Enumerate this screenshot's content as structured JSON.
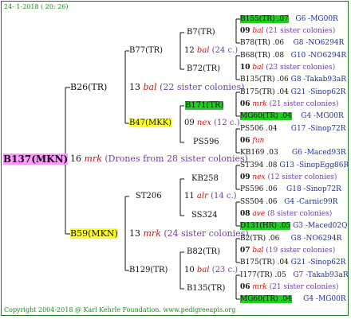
{
  "date": "24- 1-2018 ( 20: 26)",
  "footer": "Copyright 2004-2018 @ Karl Kehrle Foundation.   www.pedigreeapis.org",
  "root": {
    "id": "B137(MKN)",
    "num": "16",
    "race": "mrk",
    "note": "(Drones from 28 sister colonies)"
  },
  "gen1": {
    "top": {
      "id": "B26(TR)",
      "num": "13",
      "race": "bal",
      "note": "(22 sister colonies)"
    },
    "bottom": {
      "id": "B59(MKN)",
      "num": "13",
      "race": "mrk",
      "note": "(24 sister colonies)"
    }
  },
  "gen2": [
    {
      "id": "B77(TR)",
      "num": "12",
      "race": "bal",
      "note": "(24 c.)"
    },
    {
      "id": "B47(MKK)",
      "num": "09",
      "race": "nex",
      "note": "(12 c.)"
    },
    {
      "id": "ST206",
      "num": "11",
      "race": "alr",
      "note": "(14 c.)"
    },
    {
      "id": "B129(TR)",
      "num": "10",
      "race": "bal",
      "note": "(23 c.)"
    }
  ],
  "gen3": [
    "B7(TR)",
    "B72(TR)",
    "B171(TR)",
    "PS596",
    "KB258",
    "SS324",
    "B82(TR)",
    "B135(TR)"
  ],
  "right": [
    {
      "id": "B155(TR) .07",
      "loc": "G6 -MG00R"
    },
    {
      "num": "09",
      "race": "bal",
      "note": "(21 sister colonies)"
    },
    {
      "id": "B78(TR) .06",
      "loc": "G8 -NO6294R"
    },
    {
      "id": "B68(TR) .08",
      "loc": "G10 -NO6294R"
    },
    {
      "num": "10",
      "race": "bal",
      "note": "(23 sister colonies)"
    },
    {
      "id": "B135(TR) .06",
      "loc": "G8 -Takab93aR"
    },
    {
      "id": "B175(TR) .04",
      "loc": "G21 -Sinop62R"
    },
    {
      "num": "06",
      "race": "mrk",
      "note": "(21 sister colonies)"
    },
    {
      "id": "MG60(TR) .04",
      "loc": "G4 -MG00R"
    },
    {
      "id": "PS506 .04",
      "loc": "G17 -Sinop72R"
    },
    {
      "num": "06",
      "race": "fun",
      "note": ""
    },
    {
      "id": "KB169 .03",
      "loc": "G6 -Maced93R"
    },
    {
      "id": "ST394 .08",
      "loc": "G13 -SinopEgg86R"
    },
    {
      "num": "09",
      "race": "nex",
      "note": "(12 sister colonies)"
    },
    {
      "id": "PS596 .06",
      "loc": "G18 -Sinop72R"
    },
    {
      "id": "SS504 .06",
      "loc": "G4 -Carnic99R"
    },
    {
      "num": "08",
      "race": "ave",
      "note": "(8 sister colonies)"
    },
    {
      "id": "D131(HR) .05",
      "loc": "G3 -Maced02Q"
    },
    {
      "id": "B2(TR) .06",
      "loc": "G8 -NO6294R"
    },
    {
      "num": "07",
      "race": "bal",
      "note": "(19 sister colonies)"
    },
    {
      "id": "B175(TR) .04",
      "loc": "G21 -Sinop62R"
    },
    {
      "id": "I177(TR) .05",
      "loc": "G7 -Takab93aR"
    },
    {
      "num": "06",
      "race": "mrk",
      "note": "(21 sister colonies)"
    },
    {
      "id": "MG60(TR) .04",
      "loc": "G4 -MG00R"
    }
  ],
  "colors": {
    "green_highlight": "#22cc22",
    "yellow_highlight": "#ffff22",
    "pink_highlight": "#ff99ff",
    "race_red": "#d01010",
    "note_purple": "#6b3fa0",
    "loc_blue": "#1e2bb0",
    "frame": "#1c7a1c"
  }
}
